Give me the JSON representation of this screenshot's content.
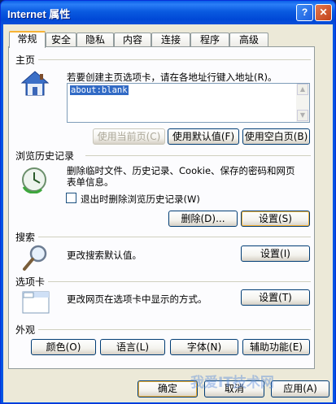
{
  "window": {
    "title": "Internet 属性",
    "help_glyph": "?",
    "close_glyph": "✕"
  },
  "tabs": [
    "常规",
    "安全",
    "隐私",
    "内容",
    "连接",
    "程序",
    "高级"
  ],
  "home": {
    "group_label": "主页",
    "description": "若要创建主页选项卡，请在各地址行键入地址(R)。",
    "address": "about:blank",
    "btn_current": "使用当前页(C)",
    "btn_default": "使用默认值(F)",
    "btn_blank": "使用空白页(B)"
  },
  "history": {
    "group_label": "浏览历史记录",
    "description_line1": "删除临时文件、历史记录、Cookie、保存的密码和网页",
    "description_line2": "表单信息。",
    "checkbox_label": "退出时删除浏览历史记录(W)",
    "btn_delete": "删除(D)...",
    "btn_settings": "设置(S)"
  },
  "search": {
    "group_label": "搜索",
    "description": "更改搜索默认值。",
    "btn_settings": "设置(I)"
  },
  "tabsection": {
    "group_label": "选项卡",
    "description": "更改网页在选项卡中显示的方式。",
    "btn_settings": "设置(T)"
  },
  "appearance": {
    "group_label": "外观",
    "btn_colors": "颜色(O)",
    "btn_languages": "语言(L)",
    "btn_fonts": "字体(N)",
    "btn_accessibility": "辅助功能(E)"
  },
  "footer": {
    "ok": "确定",
    "cancel": "取消",
    "apply": "应用(A)"
  },
  "watermark": "我爱IT技术网"
}
